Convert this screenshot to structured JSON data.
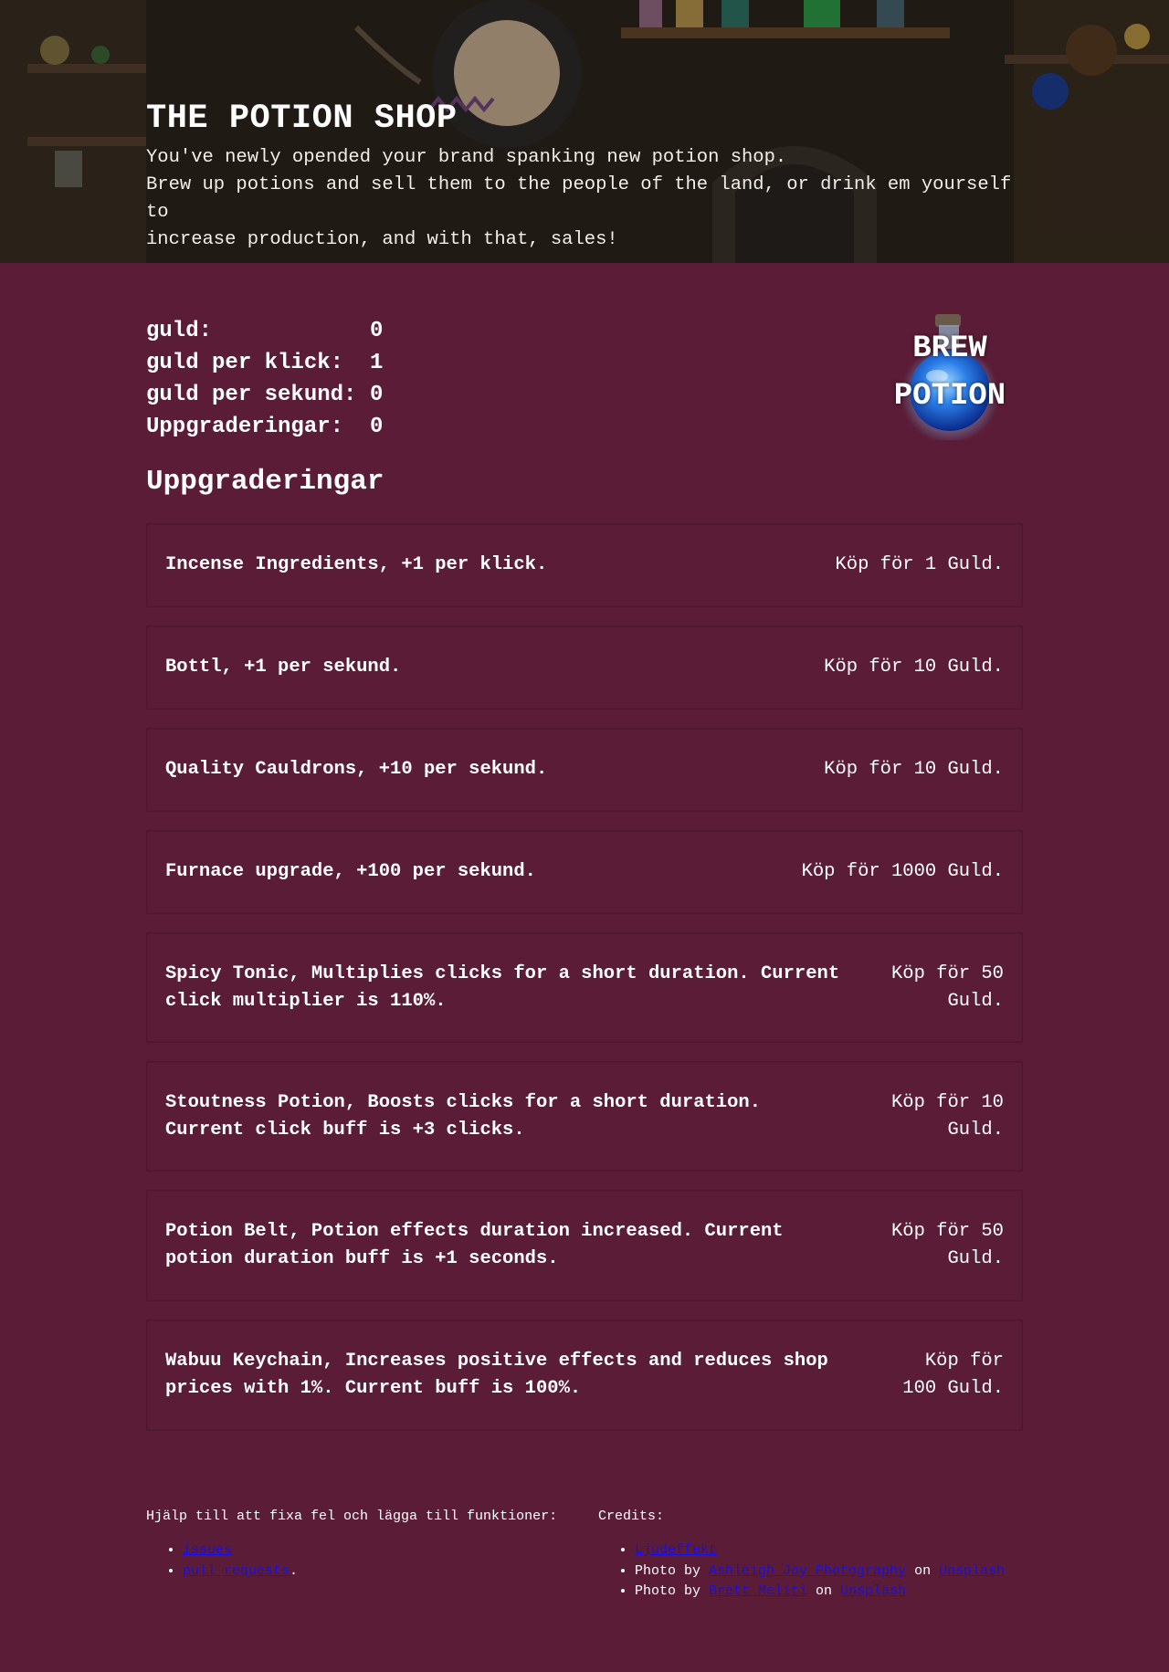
{
  "hero": {
    "title": "THE POTION SHOP",
    "line1": "You've newly opended your brand spanking new potion shop.",
    "line2": "Brew up potions and sell them to the people of the land, or drink em yourself to",
    "line3": "increase production, and with that, sales!"
  },
  "stats": [
    {
      "label": "guld:",
      "value": "0"
    },
    {
      "label": "guld per klick:",
      "value": "1"
    },
    {
      "label": "guld per sekund:",
      "value": "0"
    },
    {
      "label": "Uppgraderingar:",
      "value": "0"
    }
  ],
  "brew_button": {
    "line1": "BREW",
    "line2": "POTION"
  },
  "upgrades_heading": "Uppgraderingar",
  "upgrades": [
    {
      "name": "Incense Ingredients, +1 per klick.",
      "price": "Köp för 1 Guld."
    },
    {
      "name": "Bottl, +1 per sekund.",
      "price": "Köp för 10 Guld."
    },
    {
      "name": "Quality Cauldrons, +10 per sekund.",
      "price": "Köp för 10 Guld."
    },
    {
      "name": "Furnace upgrade, +100 per sekund.",
      "price": "Köp för 1000 Guld."
    },
    {
      "name": "Spicy Tonic, Multiplies clicks for a short duration. Current click multiplier is 110%.",
      "price": "Köp för 50 Guld."
    },
    {
      "name": "Stoutness Potion, Boosts clicks for a short duration. Current click buff is +3 clicks.",
      "price": "Köp för 10 Guld."
    },
    {
      "name": "Potion Belt, Potion effects duration increased. Current potion duration buff is +1 seconds.",
      "price": "Köp för 50 Guld."
    },
    {
      "name": "Wabuu Keychain, Increases positive effects and reduces shop prices with 1%. Current buff is 100%.",
      "price": "Köp för 100 Guld."
    }
  ],
  "footer": {
    "help_heading": "Hjälp till att fixa fel och lägga till funktioner:",
    "help_links": [
      {
        "text": "issues",
        "suffix": ""
      },
      {
        "text": "pull requests",
        "suffix": "."
      }
    ],
    "credits_heading": "Credits:",
    "credits": {
      "sound": "Ljudeffekt",
      "photo1": {
        "prefix": "Photo by ",
        "author": "Ashleigh Joy Photography",
        "on": " on ",
        "site": "Unsplash"
      },
      "photo2": {
        "prefix": "Photo by ",
        "author": "Brett Meliti",
        "on": " on ",
        "site": "Unsplash"
      }
    }
  },
  "colors": {
    "background": "#5a1c36",
    "link": "#1a0fe0",
    "text": "#ffffff"
  }
}
